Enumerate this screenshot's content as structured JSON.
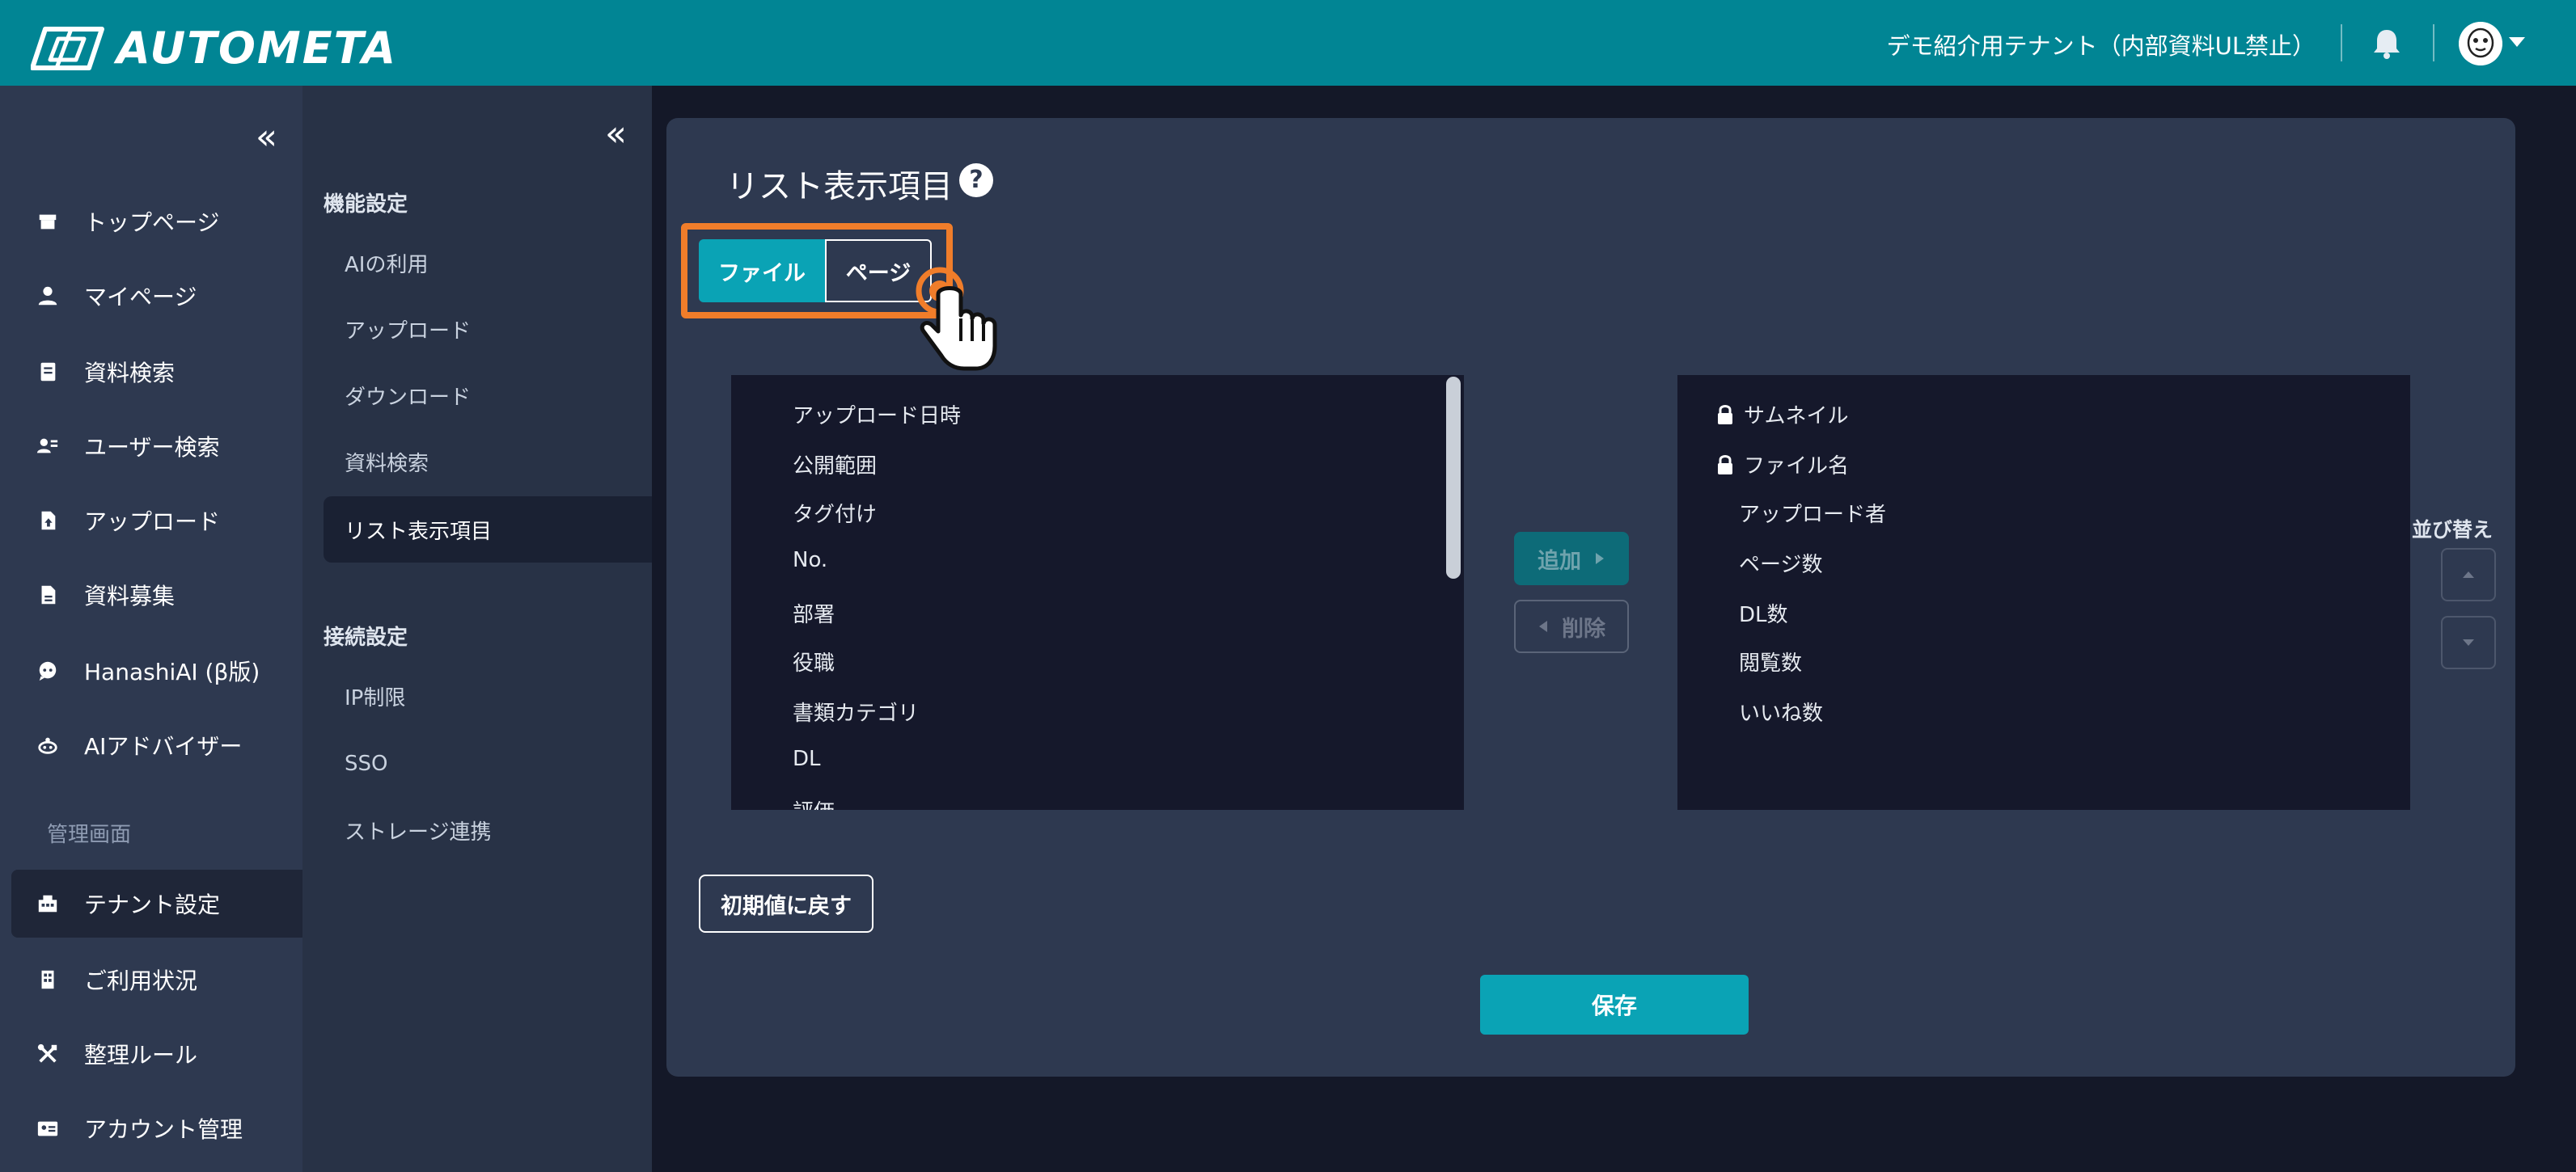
{
  "header": {
    "app_name": "AUTOMETA",
    "tenant_name": "デモ紹介用テナント（内部資料UL禁止）",
    "icons": [
      "autometa-logo-icon",
      "bell-icon",
      "avatar",
      "chevron-down-icon"
    ]
  },
  "sidebar": {
    "collapse_label": "«",
    "items": [
      {
        "label": "トップページ",
        "icon": "home-icon"
      },
      {
        "label": "マイページ",
        "icon": "user-icon"
      },
      {
        "label": "資料検索",
        "icon": "document-search-icon"
      },
      {
        "label": "ユーザー検索",
        "icon": "user-search-icon"
      },
      {
        "label": "アップロード",
        "icon": "upload-file-icon"
      },
      {
        "label": "資料募集",
        "icon": "file-icon"
      },
      {
        "label": "HanashiAI (β版)",
        "icon": "chat-ai-icon"
      },
      {
        "label": "AIアドバイザー",
        "icon": "robot-icon"
      }
    ],
    "admin_section": "管理画面",
    "admin_items": [
      {
        "label": "テナント設定",
        "icon": "tenant-icon",
        "active": true
      },
      {
        "label": "ご利用状況",
        "icon": "building-icon"
      },
      {
        "label": "整理ルール",
        "icon": "tools-icon"
      },
      {
        "label": "アカウント管理",
        "icon": "id-card-icon"
      }
    ]
  },
  "subnav": {
    "collapse_label": "«",
    "function_heading": "機能設定",
    "function_items": [
      "AIの利用",
      "アップロード",
      "ダウンロード",
      "資料検索",
      "リスト表示項目"
    ],
    "active_item": "リスト表示項目",
    "connection_heading": "接続設定",
    "connection_items": [
      "IP制限",
      "SSO",
      "ストレージ連携"
    ]
  },
  "main": {
    "title": "リスト表示項目",
    "help_label": "?",
    "tabs": [
      {
        "label": "ファイル",
        "selected": true
      },
      {
        "label": "ページ",
        "selected": false
      }
    ],
    "available_items": [
      "アップロード日時",
      "公開範囲",
      "タグ付け",
      "No.",
      "部署",
      "役職",
      "書類カテゴリ",
      "DL",
      "評価"
    ],
    "selected_items": [
      {
        "label": "サムネイル",
        "locked": true
      },
      {
        "label": "ファイル名",
        "locked": true
      },
      {
        "label": "アップロード者",
        "locked": false
      },
      {
        "label": "ページ数",
        "locked": false
      },
      {
        "label": "DL数",
        "locked": false
      },
      {
        "label": "閲覧数",
        "locked": false
      },
      {
        "label": "いいね数",
        "locked": false
      }
    ],
    "add_label": "追加",
    "remove_label": "削除",
    "sort_label": "並び替え",
    "reset_label": "初期値に戻す",
    "save_label": "保存"
  },
  "colors": {
    "header": "#018594",
    "accent": "#0aa3b5",
    "highlight": "#f07d2a",
    "sidebar": "#2e3950",
    "list_bg": "#15182b"
  }
}
